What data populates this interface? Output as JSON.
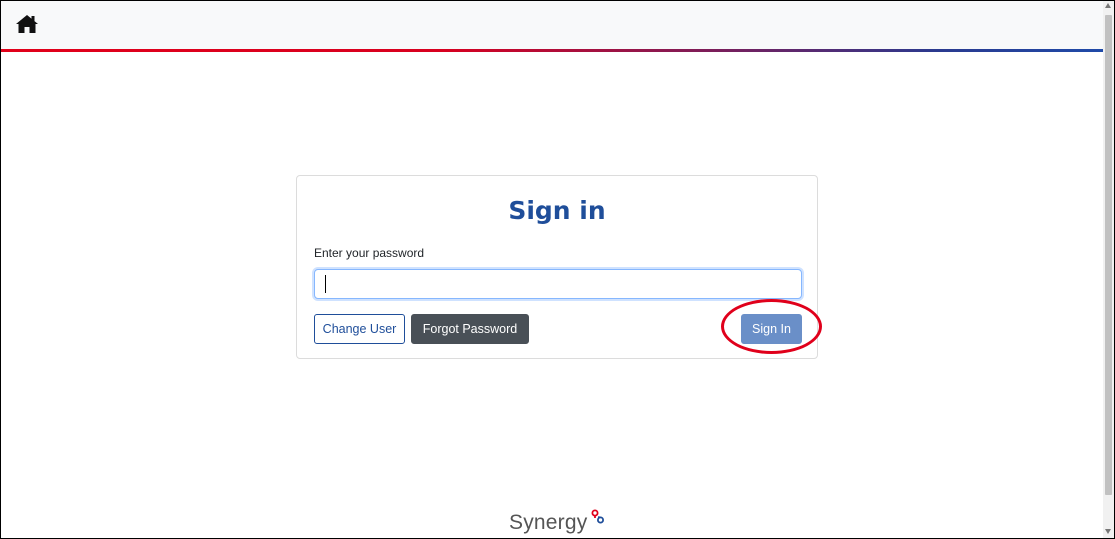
{
  "header": {
    "home_icon": "home-icon",
    "accent_gradient": [
      "#e1001a",
      "#1f4aa8"
    ]
  },
  "signin": {
    "title": "Sign in",
    "password_label": "Enter your password",
    "password_value": "",
    "change_user_label": "Change User",
    "forgot_password_label": "Forgot Password",
    "signin_button_label": "Sign In"
  },
  "footer": {
    "brand": "Synergy",
    "logo_icon": "synergy-logo-icon"
  },
  "colors": {
    "title": "#1f4e9a",
    "primary_button": "#6a8fc8",
    "dark_button": "#495057",
    "highlight": "#e0001b"
  }
}
